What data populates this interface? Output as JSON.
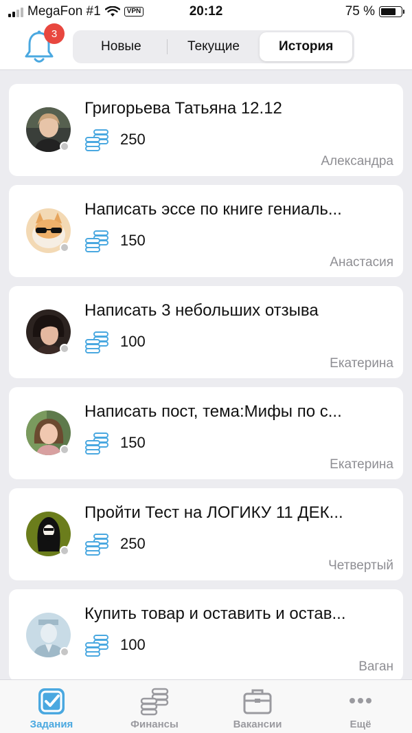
{
  "status_bar": {
    "carrier": "MegaFon #1",
    "vpn": "VPN",
    "time": "20:12",
    "battery": "75 %",
    "battery_level": 0.75
  },
  "header": {
    "notifications_count": "3",
    "tabs": [
      {
        "label": "Новые",
        "active": false
      },
      {
        "label": "Текущие",
        "active": false
      },
      {
        "label": "История",
        "active": true
      }
    ]
  },
  "tasks": [
    {
      "title": "Григорьева Татьяна 12.12",
      "amount": "250",
      "author": "Александра",
      "avatar": "woman-photo-1"
    },
    {
      "title": "Написать эссе по книге гениаль...",
      "amount": "150",
      "author": "Анастасия",
      "avatar": "cat-sunglasses-photo"
    },
    {
      "title": "Написать 3 небольших отзыва",
      "amount": "100",
      "author": "Екатерина",
      "avatar": "woman-photo-2"
    },
    {
      "title": "Написать пост, тема:Мифы по с...",
      "amount": "150",
      "author": "Екатерина",
      "avatar": "woman-photo-3"
    },
    {
      "title": "Пройти Тест на ЛОГИКУ 11 ДЕК...",
      "amount": "250",
      "author": "Четвертый",
      "avatar": "man-silhouette-green"
    },
    {
      "title": "Купить товар и оставить и остав...",
      "amount": "100",
      "author": "Ваган",
      "avatar": "default-avatar"
    }
  ],
  "tab_bar": [
    {
      "label": "Задания",
      "icon": "checkbox-icon",
      "active": true
    },
    {
      "label": "Финансы",
      "icon": "coins-icon",
      "active": false
    },
    {
      "label": "Вакансии",
      "icon": "briefcase-icon",
      "active": false
    },
    {
      "label": "Ещё",
      "icon": "more-dots-icon",
      "active": false
    }
  ],
  "colors": {
    "accent": "#4aa8e0",
    "badge": "#e8473f",
    "background": "#ececf0",
    "muted": "#8e8e93"
  }
}
